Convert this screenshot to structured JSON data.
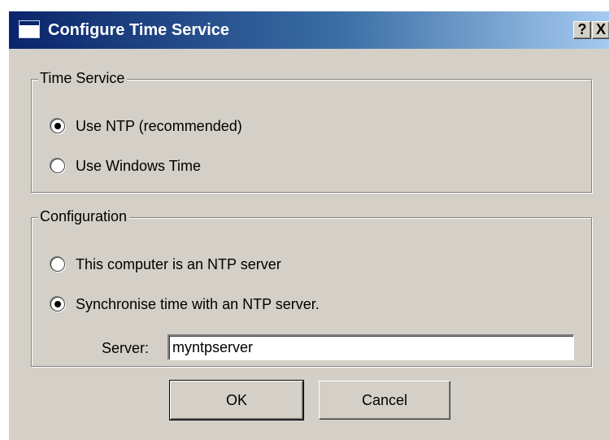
{
  "window": {
    "title": "Configure Time Service",
    "help_label": "?",
    "close_label": "X"
  },
  "time_service": {
    "legend": "Time Service",
    "options": [
      {
        "label": "Use NTP (recommended)",
        "checked": true
      },
      {
        "label": "Use Windows Time",
        "checked": false
      }
    ]
  },
  "configuration": {
    "legend": "Configuration",
    "options": [
      {
        "label": "This computer is an NTP server",
        "checked": false
      },
      {
        "label": "Synchronise time with an NTP server.",
        "checked": true
      }
    ],
    "server_label": "Server:",
    "server_value": "myntpserver"
  },
  "buttons": {
    "ok_label": "OK",
    "cancel_label": "Cancel"
  },
  "colors": {
    "titlebar_start": "#0a246a",
    "titlebar_end": "#a6caf0",
    "face": "#d4d0c8"
  },
  "icons": {
    "title": "window-icon",
    "help": "help-question-icon",
    "close": "close-x-icon"
  }
}
